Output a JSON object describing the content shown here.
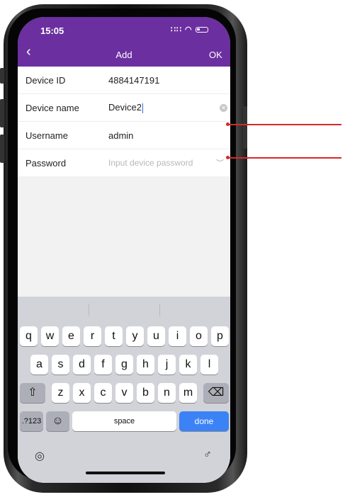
{
  "status": {
    "time": "15:05",
    "signal": "∷∷",
    "wifi": "◠"
  },
  "nav": {
    "back": "‹",
    "title": "Add",
    "ok": "OK"
  },
  "form": {
    "device_id": {
      "label": "Device ID",
      "value": "4884147191"
    },
    "device_name": {
      "label": "Device name",
      "value": "Device2"
    },
    "username": {
      "label": "Username",
      "value": "admin"
    },
    "password": {
      "label": "Password",
      "placeholder": "Input device password"
    }
  },
  "keyboard": {
    "row1": [
      "q",
      "w",
      "e",
      "r",
      "t",
      "y",
      "u",
      "i",
      "o",
      "p"
    ],
    "row2": [
      "a",
      "s",
      "d",
      "f",
      "g",
      "h",
      "j",
      "k",
      "l"
    ],
    "row3": [
      "z",
      "x",
      "c",
      "v",
      "b",
      "n",
      "m"
    ],
    "numbers_key": ".?123",
    "space_key": "space",
    "done_key": "done",
    "shift_glyph": "⇧",
    "delete_glyph": "⌫",
    "emoji_glyph": "☺",
    "globe_glyph": "◎",
    "mic_glyph": "♂"
  },
  "colors": {
    "header": "#6b2fa0",
    "done_key": "#3b82f6",
    "annotation": "#d62828"
  }
}
